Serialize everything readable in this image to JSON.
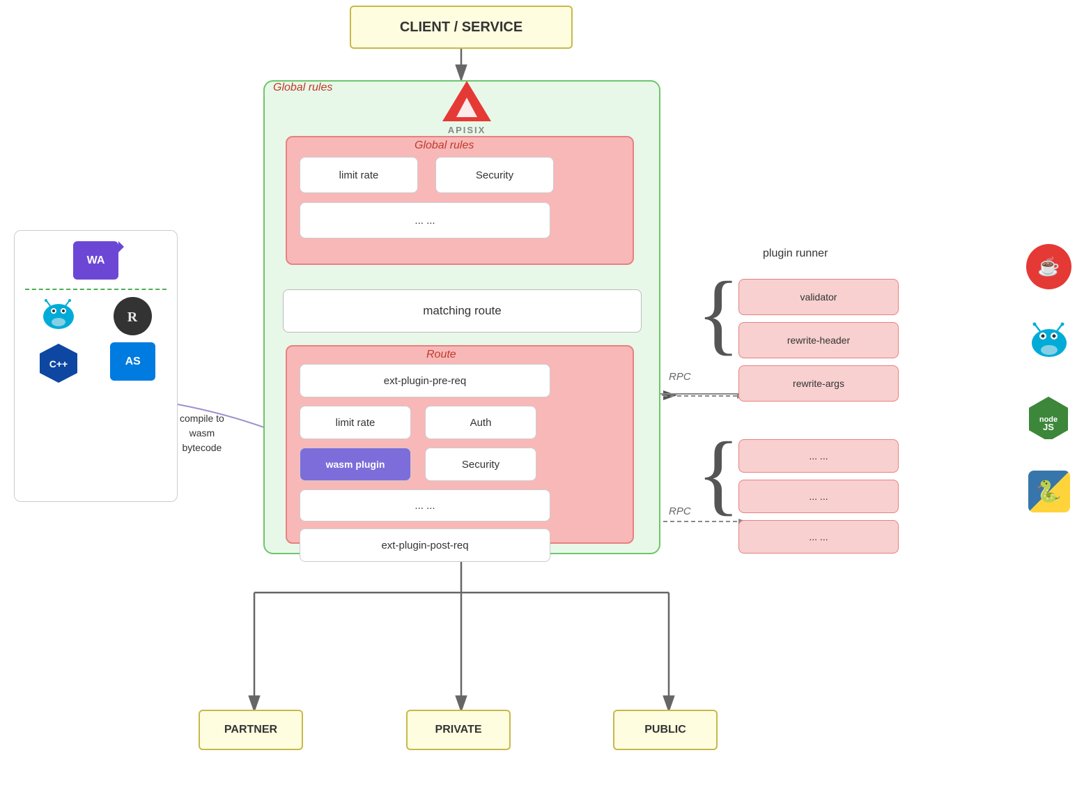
{
  "client": {
    "label": "CLIENT / SERVICE"
  },
  "apisix": {
    "text": "APISIX"
  },
  "globalRules": {
    "label": "Global rules",
    "limitRate": "limit rate",
    "security": "Security",
    "dots": "... ..."
  },
  "matchingRoute": {
    "label": "matching route"
  },
  "route": {
    "label": "Route",
    "extPreReq": "ext-plugin-pre-req",
    "limitRate": "limit rate",
    "auth": "Auth",
    "wasmPlugin": "wasm plugin",
    "security": "Security",
    "dots": "... ...",
    "extPostReq": "ext-plugin-post-req"
  },
  "pluginRunner": {
    "label": "plugin runner",
    "validator": "validator",
    "rewriteHeader": "rewrite-header",
    "rewriteArgs": "rewrite-args",
    "rpc": "RPC",
    "dots1": "... ...",
    "dots2": "... ...",
    "dots3": "... ...",
    "rpc2": "RPC"
  },
  "bottom": {
    "partner": "PARTNER",
    "private": "PRIVATE",
    "public": "PUBLIC"
  },
  "leftPanel": {
    "wa": "WA",
    "compileText": "compile to\nwasm\nbytecode",
    "cpp": "C++",
    "as": "AS"
  }
}
